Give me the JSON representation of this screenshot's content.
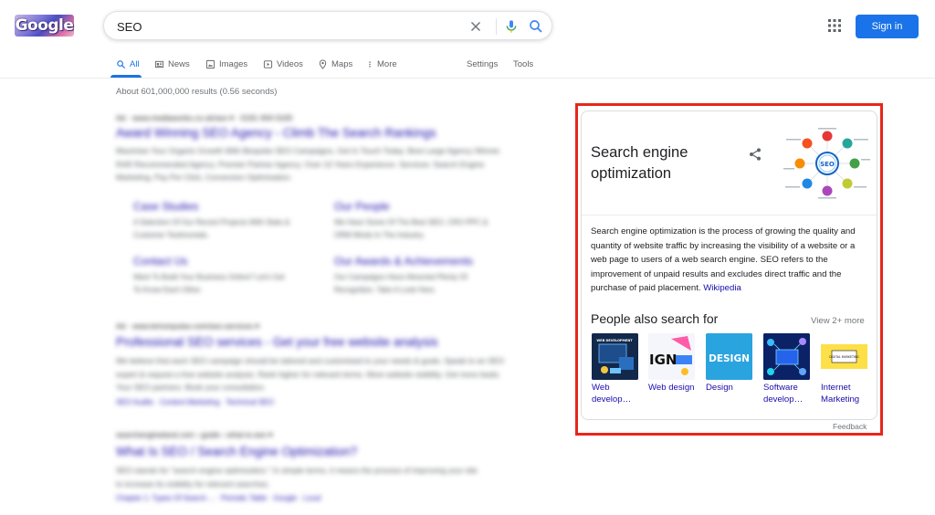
{
  "header": {
    "logo_text": "Google",
    "search_value": "SEO",
    "sign_in_label": "Sign in",
    "accent_color": "#1a73e8"
  },
  "tabs": [
    {
      "label": "All",
      "icon": "search-icon",
      "active": true
    },
    {
      "label": "News",
      "icon": "news-icon"
    },
    {
      "label": "Images",
      "icon": "image-icon"
    },
    {
      "label": "Videos",
      "icon": "video-icon"
    },
    {
      "label": "Maps",
      "icon": "map-pin-icon"
    },
    {
      "label": "More",
      "icon": "more-vert-icon"
    },
    {
      "label": "Settings"
    },
    {
      "label": "Tools"
    }
  ],
  "stats": "About 601,000,000 results (0.56 seconds)",
  "results": [
    {
      "url": "Ad · www.mediaworks.co.uk/seo ▾ · 0191 404 0100",
      "title": "Award Winning SEO Agency - Climb The Search Rankings",
      "snippet": "Maximise Your Organic Growth With Bespoke SEO Campaigns. Get In Touch Today. Best Large Agency Winner. RAR Recommended Agency. Premier Partner Agency. Over 10 Years Experience. Services: Search Engine Marketing, Pay Per Click, Conversion Optimisation.",
      "sitelinks": [
        {
          "title": "Case Studies",
          "desc": "A Selection Of Our Recent Projects With Stats & Customer Testimonials."
        },
        {
          "title": "Our People",
          "desc": "We Have Some Of The Best SEO, CRO PPC & ORM Minds In The Industry."
        },
        {
          "title": "Contact Us",
          "desc": "Want To Build Your Business Online? Let's Get To Know Each Other."
        },
        {
          "title": "Our Awards & Achievements",
          "desc": "Our Campaigns Have Attracted Plenty Of Recognition. Take A Look Here."
        }
      ]
    },
    {
      "url": "Ad · www.lemonpulse.com/seo-services ▾",
      "title": "Professional SEO services - Get your free website analysis",
      "snippet": "We believe that each SEO campaign should be tailored and customised to your needs & goals. Speak to an SEO expert & request a free website analysis. Rank higher for relevant terms. More website visibility. Get more leads. Your SEO partners. Book your consultation.",
      "links": "SEO Audits · Content Marketing · Technical SEO"
    },
    {
      "url": "searchengineland.com › guide › what-is-seo ▾",
      "title": "What Is SEO / Search Engine Optimization?",
      "snippet": "SEO stands for \"search engine optimization.\" In simple terms, it means the process of improving your site to increase its visibility for relevant searches.",
      "links": "Chapter 1: Types Of Search ... · Periodic Table · Google · Local"
    }
  ],
  "knowledge_panel": {
    "title": "Search engine optimization",
    "diagram_center_label": "SEO",
    "description": "Search engine optimization is the process of growing the quality and quantity of website traffic by increasing the visibility of a website or a web page to users of a web search engine. SEO refers to the improvement of unpaid results and excludes direct traffic and the purchase of paid placement.",
    "source_link": "Wikipedia",
    "people_also_search_title": "People also search for",
    "view_more": "View 2+ more",
    "related": [
      {
        "label": "Web develop…",
        "image_text": "WEB DEVELOPMENT"
      },
      {
        "label": "Web design",
        "image_text": "IGN"
      },
      {
        "label": "Design",
        "image_text": "DESIGN"
      },
      {
        "label": "Software develop…",
        "image_text": ""
      },
      {
        "label": "Internet Marketing",
        "image_text": "DIGITAL MARKETING"
      }
    ],
    "feedback": "Feedback",
    "highlight_color": "#e8261a"
  }
}
